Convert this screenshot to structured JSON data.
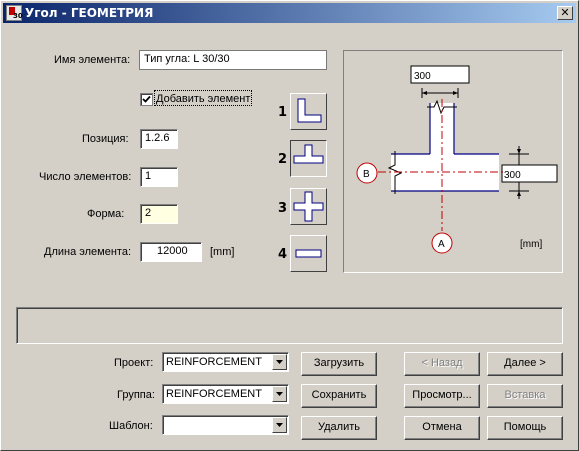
{
  "window": {
    "title": "Угол - ГЕОМЕТРИЯ",
    "app_icon_number": "30",
    "close_label": "✕"
  },
  "form": {
    "element_name_label": "Имя элемента:",
    "element_name_value": "Тип угла: L 30/30",
    "add_element_label": "Добавить элемент",
    "add_element_checked": true,
    "position_label": "Позиция:",
    "position_value": "1.2.6",
    "count_label": "Число элементов:",
    "count_value": "1",
    "shape_label": "Форма:",
    "shape_value": "2",
    "length_label": "Длина элемента:",
    "length_value": "12000",
    "length_unit": "[mm]"
  },
  "shapes": [
    {
      "number": "1",
      "icon": "l-corner-icon",
      "selected": false
    },
    {
      "number": "2",
      "icon": "t-junction-icon",
      "selected": true
    },
    {
      "number": "3",
      "icon": "cross-junction-icon",
      "selected": false
    },
    {
      "number": "4",
      "icon": "straight-bar-icon",
      "selected": false
    }
  ],
  "sketch": {
    "top_width": "300",
    "right_height": "300",
    "axis_b": "B",
    "axis_a": "A",
    "unit": "[mm]"
  },
  "status_message": "",
  "selectors": {
    "project_label": "Проект:",
    "project_value": "REINFORCEMENT",
    "group_label": "Группа:",
    "group_value": "REINFORCEMENT",
    "template_label": "Шаблон:",
    "template_value": ""
  },
  "buttons": {
    "load": "Загрузить",
    "save": "Сохранить",
    "delete": "Удалить",
    "back": "< Назад",
    "next": "Далее >",
    "preview": "Просмотр...",
    "insert": "Вставка",
    "cancel": "Отмена",
    "help": "Помощь"
  },
  "colors": {
    "title_gradient_start": "#0a246a",
    "title_gradient_end": "#a6caf0",
    "axis_red": "#c00000",
    "wall_blue": "#000080",
    "field_yellow": "#ffffe1"
  }
}
